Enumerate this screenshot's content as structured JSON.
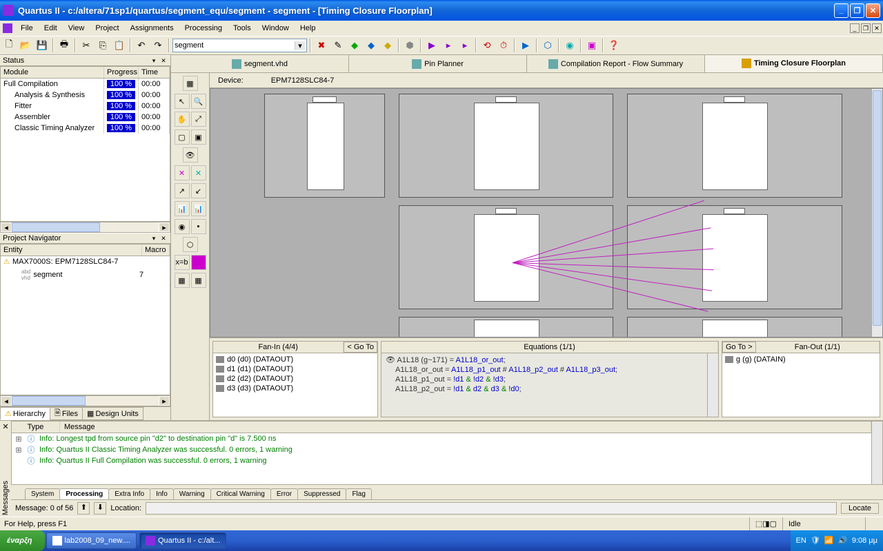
{
  "window": {
    "title": "Quartus II - c:/altera/71sp1/quartus/segment_equ/segment - segment - [Timing Closure Floorplan]"
  },
  "menu": [
    "File",
    "Edit",
    "View",
    "Project",
    "Assignments",
    "Processing",
    "Tools",
    "Window",
    "Help"
  ],
  "toolbar": {
    "combo_value": "segment"
  },
  "status_panel": {
    "title": "Status",
    "headers": {
      "module": "Module",
      "progress": "Progress %",
      "time": "Time"
    },
    "rows": [
      {
        "module": "Full Compilation",
        "progress": "100 %",
        "time": "00:00",
        "indent": false
      },
      {
        "module": "Analysis & Synthesis",
        "progress": "100 %",
        "time": "00:00",
        "indent": true
      },
      {
        "module": "Fitter",
        "progress": "100 %",
        "time": "00:00",
        "indent": true
      },
      {
        "module": "Assembler",
        "progress": "100 %",
        "time": "00:00",
        "indent": true
      },
      {
        "module": "Classic Timing Analyzer",
        "progress": "100 %",
        "time": "00:00",
        "indent": true
      }
    ]
  },
  "navigator": {
    "title": "Project Navigator",
    "headers": {
      "entity": "Entity",
      "macro": "Macro"
    },
    "device": "MAX7000S: EPM7128SLC84-7",
    "child": "segment",
    "child_count": "7",
    "tabs": [
      "Hierarchy",
      "Files",
      "Design Units"
    ],
    "active_tab": 0
  },
  "doc_tabs": [
    {
      "label": "segment.vhd",
      "active": false
    },
    {
      "label": "Pin Planner",
      "active": false
    },
    {
      "label": "Compilation Report - Flow Summary",
      "active": false
    },
    {
      "label": "Timing Closure Floorplan",
      "active": true
    }
  ],
  "device_bar": {
    "label": "Device:",
    "value": "EPM7128SLC84-7"
  },
  "fan_in": {
    "title": "Fan-In (4/4)",
    "goto": "< Go To",
    "items": [
      "d0 (d0) (DATAOUT)",
      "d1 (d1) (DATAOUT)",
      "d2 (d2) (DATAOUT)",
      "d3 (d3) (DATAOUT)"
    ]
  },
  "equations": {
    "title": "Equations (1/1)",
    "lines": [
      {
        "pre": "A1L18 (g~171) = ",
        "blue": "A1L18_or_out",
        "post": ";"
      },
      {
        "pre": "A1L18_or_out = ",
        "seg": [
          "A1L18_p1_out",
          " # ",
          "A1L18_p2_out",
          " # ",
          "A1L18_p3_out",
          ";"
        ]
      },
      {
        "pre": "A1L18_p1_out = ",
        "seg": [
          "!d1",
          " & ",
          "!d2",
          " & ",
          "!d3",
          ";"
        ]
      },
      {
        "pre": "A1L18_p2_out = ",
        "seg": [
          "!d1",
          " & ",
          "d2",
          " & ",
          "d3",
          " & ",
          "!d0",
          ";"
        ]
      }
    ]
  },
  "fan_out": {
    "goto": "Go To >",
    "title": "Fan-Out (1/1)",
    "items": [
      "g (g) (DATAIN)"
    ]
  },
  "messages": {
    "headers": {
      "type": "Type",
      "message": "Message"
    },
    "rows": [
      "Info: Longest tpd from source pin \"d2\" to destination pin \"d\" is 7.500 ns",
      "Info: Quartus II Classic Timing Analyzer was successful. 0 errors, 1 warning",
      "Info: Quartus II Full Compilation was successful. 0 errors, 1 warning"
    ],
    "tabs": [
      "System",
      "Processing",
      "Extra Info",
      "Info",
      "Warning",
      "Critical Warning",
      "Error",
      "Suppressed",
      "Flag"
    ],
    "active_tab": 1,
    "footer": {
      "count": "Message: 0 of 56",
      "loc_label": "Location:",
      "locate": "Locate"
    }
  },
  "statusbar": {
    "help": "For Help, press F1",
    "idle": "Idle"
  },
  "taskbar": {
    "start": "έναρξη",
    "items": [
      {
        "label": "lab2008_09_new....",
        "active": false
      },
      {
        "label": "Quartus II - c:/alt...",
        "active": true
      }
    ],
    "lang": "EN",
    "clock": "9:08 μμ"
  }
}
